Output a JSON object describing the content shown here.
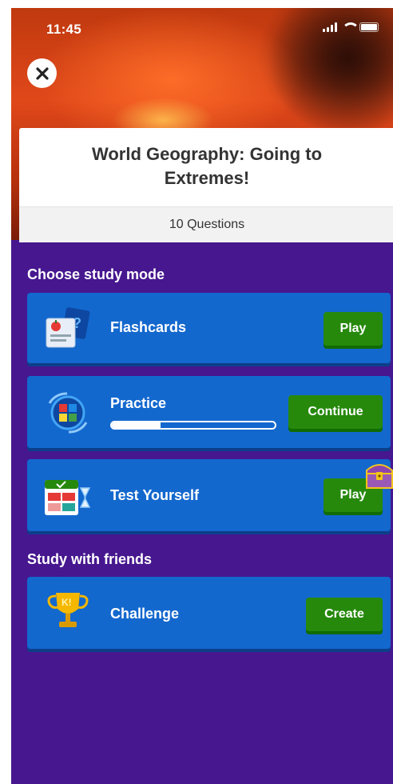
{
  "status_bar": {
    "time": "11:45",
    "icons": [
      "signal-icon",
      "wifi-icon",
      "battery-icon"
    ]
  },
  "header": {
    "close_icon": "close-icon",
    "title": "World Geography: Going to Extremes!",
    "question_count": "10 Questions"
  },
  "study_modes": {
    "heading": "Choose study mode",
    "items": [
      {
        "label": "Flashcards",
        "icon": "flashcards-icon",
        "action": "Play"
      },
      {
        "label": "Practice",
        "icon": "practice-icon",
        "action": "Continue",
        "progress": 0.3
      },
      {
        "label": "Test Yourself",
        "icon": "test-yourself-icon",
        "action": "Play",
        "badge_icon": "treasure-chest-icon"
      }
    ]
  },
  "friends": {
    "heading": "Study with friends",
    "items": [
      {
        "label": "Challenge",
        "icon": "trophy-icon",
        "action": "Create"
      }
    ]
  },
  "colors": {
    "background": "#46178f",
    "card": "#1368ce",
    "button": "#26890c"
  }
}
